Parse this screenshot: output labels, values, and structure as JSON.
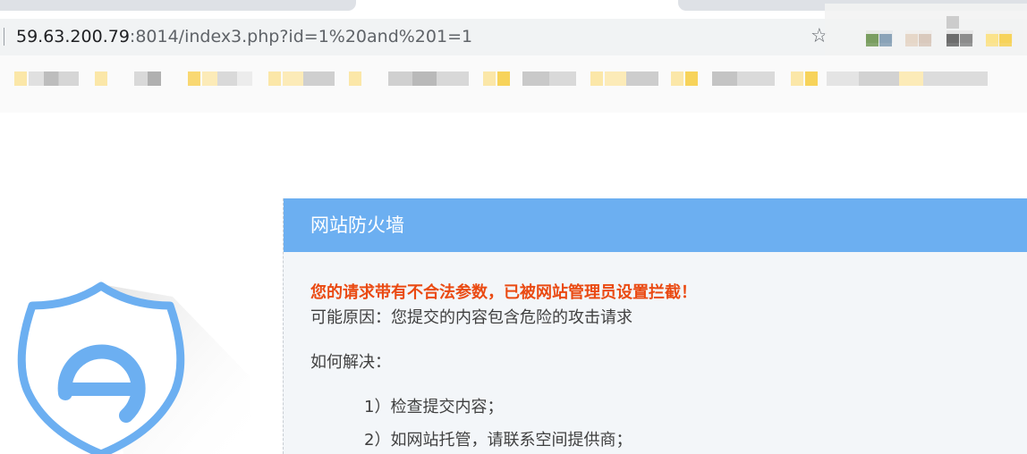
{
  "browser": {
    "url_host": "59.63.200.79",
    "url_rest": ":8014/index3.php?id=1%20and%201=1",
    "star_icon": "☆",
    "colors": {
      "toolbar": "#f1f3f4",
      "bookmarks_bar": "#fafafa"
    }
  },
  "page": {
    "logo_icon": "shield-e-icon",
    "firewall": {
      "title": "网站防火墙",
      "warning": "您的请求带有不合法参数，已被网站管理员设置拦截！",
      "reason": "可能原因：您提交的内容包含危险的攻击请求",
      "solve_heading": "如何解决：",
      "steps": [
        "1）检查提交内容；",
        "2）如网站托管，请联系空间提供商；"
      ],
      "colors": {
        "header": "#6caff1",
        "warning": "#ea4a12",
        "body_text": "#404040",
        "panel": "#f3f6f9"
      }
    }
  }
}
